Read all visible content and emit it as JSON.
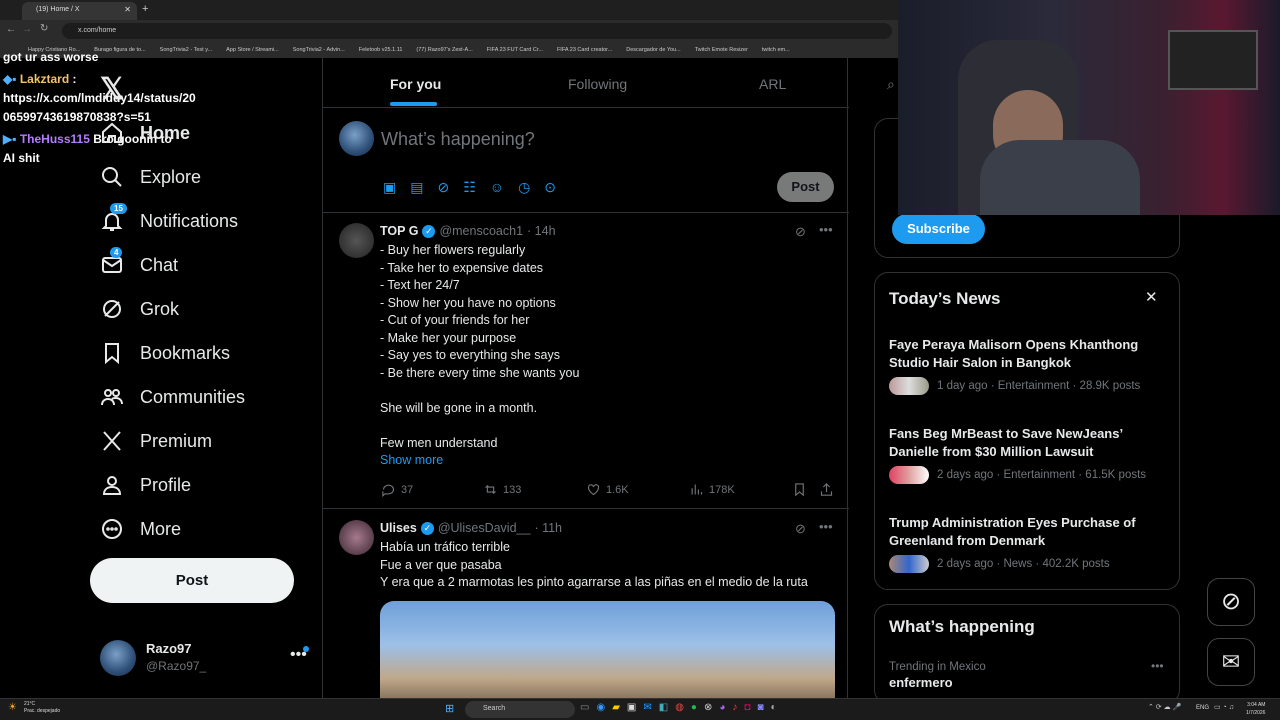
{
  "browser": {
    "tab_title": "(19) Home / X",
    "url": "x.com/home",
    "bookmarks": [
      "Happy Cristiano Ro...",
      "Burago figura de to...",
      "SongTrivia2 - Test y...",
      "App Store / Streami...",
      "SongTrivia2 - Advin...",
      "Feletoob v25.1.11",
      "(77) Razo97's Zest-A...",
      "FIFA 23 FUT Card Cr...",
      "FIFA 23 Card creator...",
      "Descargador de You...",
      "Twitch Emote Resizer",
      "twitch em..."
    ]
  },
  "chat": {
    "line0": "got ur ass worse",
    "user1": "Lakztard",
    "msg1_line1": "https://x.com/lmdiddy14/status/20",
    "msg1_line2": "06599743619870838?s=51",
    "user2": "TheHuss115",
    "msg2_line1": "Bro goonin to",
    "msg2_line2": "AI shit"
  },
  "nav": {
    "home": "Home",
    "explore": "Explore",
    "notifications": "Notifications",
    "notifications_badge": "15",
    "chat": "Chat",
    "chat_badge": "4",
    "grok": "Grok",
    "bookmarks": "Bookmarks",
    "communities": "Communities",
    "premium": "Premium",
    "profile": "Profile",
    "more": "More",
    "post_button": "Post"
  },
  "account": {
    "name": "Razo97",
    "handle": "@Razo97_"
  },
  "tabs": {
    "for_you": "For you",
    "following": "Following",
    "arl": "ARL"
  },
  "composer": {
    "placeholder": "What’s happening?",
    "post_button": "Post"
  },
  "tweet1": {
    "name": "TOP G",
    "handle": "@menscoach1",
    "time": "· 14h",
    "lines": [
      "- Buy her flowers regularly",
      "- Take her to expensive dates",
      "- Text her 24/7",
      "- Show her you have no options",
      "- Cut of your friends for her",
      "- Make her your purpose",
      "- Say yes to everything she says",
      "- Be there every time she wants you",
      "",
      "She will be gone in a month.",
      "",
      "Few men understand"
    ],
    "show_more": "Show more",
    "replies": "37",
    "reposts": "133",
    "likes": "1.6K",
    "views": "178K"
  },
  "tweet2": {
    "name": "Ulises",
    "handle": "@UlisesDavid__",
    "time": "· 11h",
    "lines": [
      "Había un tráfico terrible",
      "Fue a ver que pasaba",
      "Y era que a 2 marmotas les pinto agarrarse a las piñas en el medio de la ruta"
    ]
  },
  "right": {
    "subscribe": "Subscribe",
    "news_header": "Today’s News",
    "news": [
      {
        "title": "Faye Peraya Malisorn Opens Khanthong Studio Hair Salon in Bangkok",
        "meta": "1 day ago · Entertainment · 28.9K posts"
      },
      {
        "title": "Fans Beg MrBeast to Save NewJeans’ Danielle from $30 Million Lawsuit",
        "meta": "2 days ago · Entertainment · 61.5K posts"
      },
      {
        "title": "Trump Administration Eyes Purchase of Greenland from Denmark",
        "meta": "2 days ago · News · 402.2K posts"
      }
    ],
    "happening_header": "What’s happening",
    "trend_context": "Trending in Mexico",
    "trend_name": "enfermero"
  },
  "taskbar": {
    "weather_temp": "21°C",
    "weather_desc": "Prac. despejado",
    "search": "Search",
    "lang": "ENG",
    "time": "3:04 AM",
    "date": "1/7/2026"
  },
  "colors": {
    "accent": "#1d9bf0",
    "background": "#000000",
    "border": "#2f3336",
    "muted": "#71767b"
  }
}
